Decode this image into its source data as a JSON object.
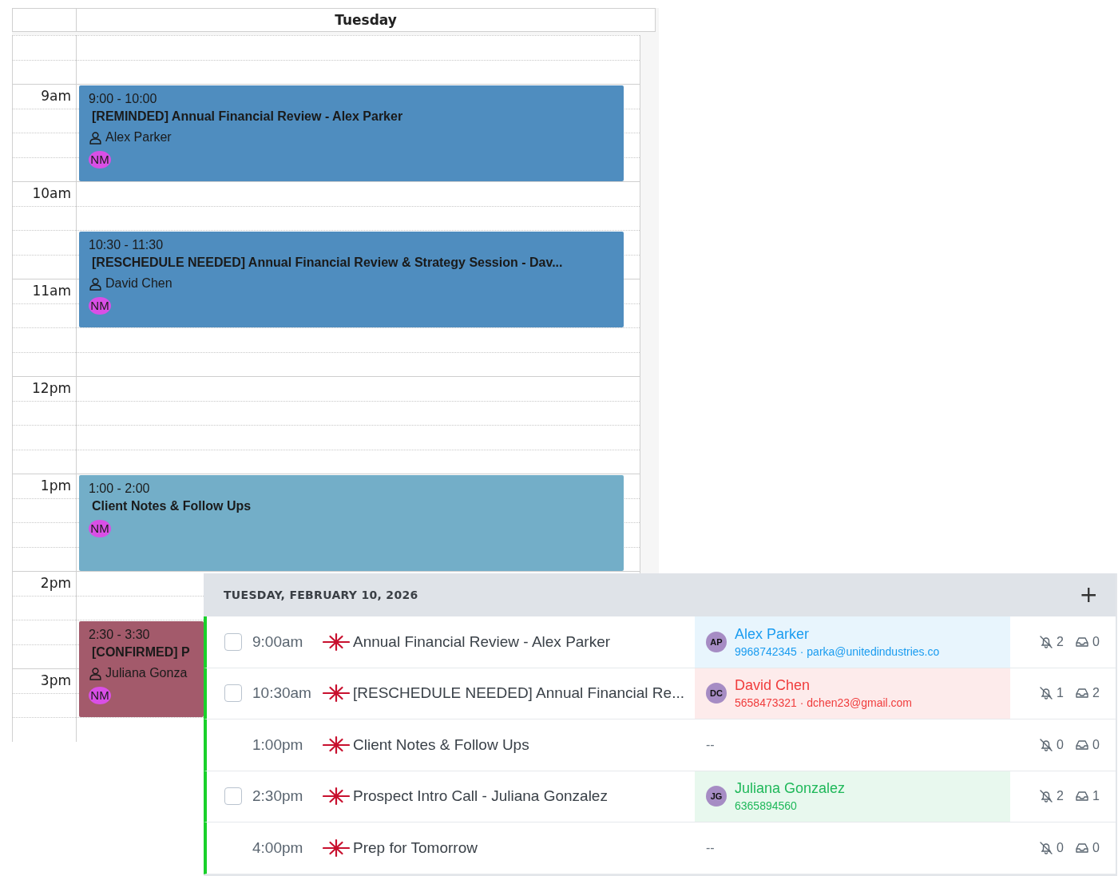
{
  "calendar": {
    "day": "Tuesday",
    "hours": [
      "9am",
      "10am",
      "11am",
      "12pm",
      "1pm",
      "2pm",
      "3pm"
    ],
    "events": [
      {
        "time": "9:00 - 10:00",
        "title": "[REMINDED] Annual Financial Review - Alex Parker",
        "person": "Alex Parker",
        "initials": "NM",
        "color": "#4f8dbf"
      },
      {
        "time": "10:30 - 11:30",
        "title": "[RESCHEDULE NEEDED] Annual Financial Review & Strategy Session - Dav...",
        "person": "David Chen",
        "initials": "NM",
        "color": "#4f8dbf"
      },
      {
        "time": "1:00 - 2:00",
        "title": "Client Notes & Follow Ups",
        "initials": "NM",
        "color": "#73aec8"
      },
      {
        "time": "2:30 - 3:30",
        "title": "[CONFIRMED] P",
        "person": "Juliana Gonza",
        "initials": "NM",
        "color": "#a35a6b"
      }
    ]
  },
  "agenda": {
    "date": "TUESDAY, FEBRUARY 10, 2026",
    "add": "+",
    "rows": [
      {
        "kind": "task",
        "checked": false,
        "time": "9:00am",
        "title": "Annual Financial Review - Alex Parker",
        "contact": {
          "initials": "AP",
          "name": "Alex Parker",
          "details": "9968742345 · parka@unitedindustries.co",
          "color": "#1a9cf0"
        },
        "reminders": "2",
        "messages": "0"
      },
      {
        "kind": "task",
        "checked": false,
        "time": "10:30am",
        "title": "[RESCHEDULE NEEDED] Annual Financial Re...",
        "contact": {
          "initials": "DC",
          "name": "David Chen",
          "details": "5658473321 · dchen23@gmail.com",
          "color": "#f03c3c"
        },
        "reminders": "1",
        "messages": "2"
      },
      {
        "kind": "block",
        "time": "1:00pm",
        "title": "Client Notes & Follow Ups",
        "no_contact": "--",
        "reminders": "0",
        "messages": "0"
      },
      {
        "kind": "task",
        "checked": false,
        "time": "2:30pm",
        "title": "Prospect Intro Call - Juliana Gonzalez",
        "contact": {
          "initials": "JG",
          "name": "Juliana Gonzalez",
          "details": "6365894560",
          "color": "#1fb85a"
        },
        "reminders": "2",
        "messages": "1"
      },
      {
        "kind": "block",
        "time": "4:00pm",
        "title": "Prep for Tomorrow",
        "no_contact": "--",
        "reminders": "0",
        "messages": "0"
      }
    ]
  }
}
